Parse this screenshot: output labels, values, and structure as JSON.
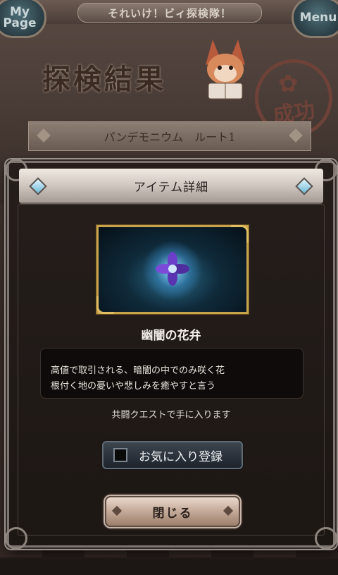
{
  "header": {
    "title": "それいけ！ビィ探検隊！",
    "mypage_label": "My Page",
    "menu_label": "Menu"
  },
  "result": {
    "heading": "探検結果",
    "status": "成功",
    "route": "パンデモニウム　ルート1"
  },
  "dialog": {
    "title": "アイテム詳細",
    "item_name": "幽闇の花弁",
    "description_line1": "高値で取引される、暗闇の中でのみ咲く花",
    "description_line2": "根付く地の憂いや悲しみを癒やすと言う",
    "source": "共闘クエストで手に入ります",
    "favorite_label": "お気に入り登録",
    "favorite_checked": false,
    "close_label": "閉じる"
  },
  "colors": {
    "accent_gold": "#c9a24c",
    "dialog_bg": "#1d1714",
    "stamp": "#6e4238"
  }
}
